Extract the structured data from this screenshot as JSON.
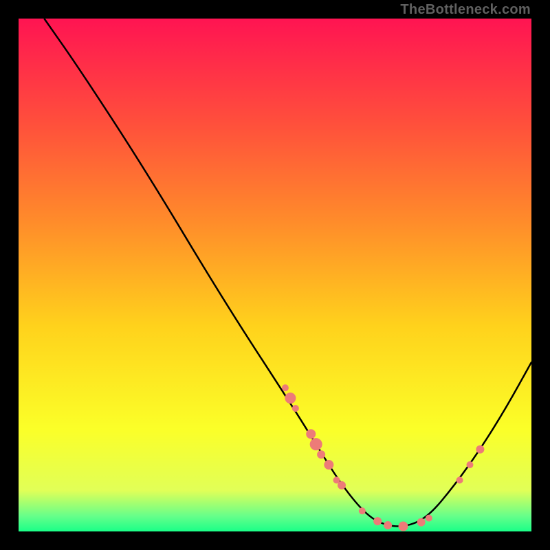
{
  "watermark": "TheBottleneck.com",
  "chart_data": {
    "type": "line",
    "title": "",
    "xlabel": "",
    "ylabel": "",
    "xlim": [
      0,
      100
    ],
    "ylim": [
      0,
      100
    ],
    "grid": false,
    "series": [
      {
        "name": "curve",
        "type": "line",
        "points": [
          {
            "x": 5,
            "y": 100
          },
          {
            "x": 12,
            "y": 90
          },
          {
            "x": 25,
            "y": 70
          },
          {
            "x": 40,
            "y": 45
          },
          {
            "x": 53,
            "y": 25
          },
          {
            "x": 58,
            "y": 17
          },
          {
            "x": 63,
            "y": 9
          },
          {
            "x": 68,
            "y": 3
          },
          {
            "x": 72,
            "y": 1
          },
          {
            "x": 76,
            "y": 1
          },
          {
            "x": 80,
            "y": 3
          },
          {
            "x": 85,
            "y": 9
          },
          {
            "x": 90,
            "y": 16
          },
          {
            "x": 95,
            "y": 24
          },
          {
            "x": 100,
            "y": 33
          }
        ]
      },
      {
        "name": "dots",
        "type": "scatter",
        "color": "#ed7b78",
        "points": [
          {
            "x": 52,
            "y": 28,
            "r": 1.0
          },
          {
            "x": 53,
            "y": 26,
            "r": 1.6
          },
          {
            "x": 54,
            "y": 24,
            "r": 1.0
          },
          {
            "x": 57,
            "y": 19,
            "r": 1.4
          },
          {
            "x": 58,
            "y": 17,
            "r": 1.8
          },
          {
            "x": 59,
            "y": 15,
            "r": 1.2
          },
          {
            "x": 60.5,
            "y": 13,
            "r": 1.4
          },
          {
            "x": 62,
            "y": 10,
            "r": 1.0
          },
          {
            "x": 63,
            "y": 9,
            "r": 1.2
          },
          {
            "x": 67,
            "y": 4,
            "r": 1.0
          },
          {
            "x": 70,
            "y": 2,
            "r": 1.2
          },
          {
            "x": 72,
            "y": 1.2,
            "r": 1.2
          },
          {
            "x": 75,
            "y": 1,
            "r": 1.4
          },
          {
            "x": 78.5,
            "y": 1.8,
            "r": 1.2
          },
          {
            "x": 80,
            "y": 2.6,
            "r": 1.0
          },
          {
            "x": 86,
            "y": 10,
            "r": 1.0
          },
          {
            "x": 88,
            "y": 13,
            "r": 1.0
          },
          {
            "x": 90,
            "y": 16,
            "r": 1.2
          }
        ]
      }
    ],
    "background_gradient": {
      "stops": [
        {
          "offset": 0.0,
          "color": "#ff1452"
        },
        {
          "offset": 0.2,
          "color": "#ff4e3c"
        },
        {
          "offset": 0.4,
          "color": "#ff8d2a"
        },
        {
          "offset": 0.6,
          "color": "#ffd21c"
        },
        {
          "offset": 0.8,
          "color": "#fbff28"
        },
        {
          "offset": 0.92,
          "color": "#e1ff57"
        },
        {
          "offset": 0.97,
          "color": "#66ff8a"
        },
        {
          "offset": 1.0,
          "color": "#1aff88"
        }
      ]
    }
  }
}
